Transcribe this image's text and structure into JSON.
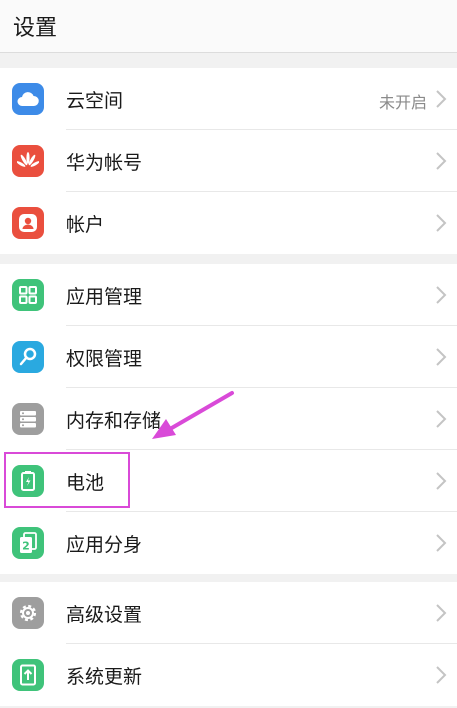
{
  "header": {
    "title": "设置"
  },
  "groups": [
    {
      "items": [
        {
          "label": "云空间",
          "status": "未开启",
          "icon": "cloud-icon",
          "color": "#3d8be8"
        },
        {
          "label": "华为帐号",
          "icon": "huawei-icon",
          "color": "#ea4f3e"
        },
        {
          "label": "帐户",
          "icon": "user-icon",
          "color": "#ea4f3e"
        }
      ]
    },
    {
      "items": [
        {
          "label": "应用管理",
          "icon": "apps-grid-icon",
          "color": "#3fc37a"
        },
        {
          "label": "权限管理",
          "icon": "key-icon",
          "color": "#2aa9e0"
        },
        {
          "label": "内存和存储",
          "icon": "storage-icon",
          "color": "#9e9e9e"
        },
        {
          "label": "电池",
          "icon": "battery-icon",
          "color": "#3fc37a"
        },
        {
          "label": "应用分身",
          "icon": "app-twin-icon",
          "color": "#3fc37a"
        }
      ]
    },
    {
      "items": [
        {
          "label": "高级设置",
          "icon": "gear-icon",
          "color": "#9e9e9e"
        },
        {
          "label": "系统更新",
          "icon": "update-icon",
          "color": "#3fc37a"
        }
      ]
    }
  ],
  "annotation": {
    "color": "#d94ad8"
  }
}
